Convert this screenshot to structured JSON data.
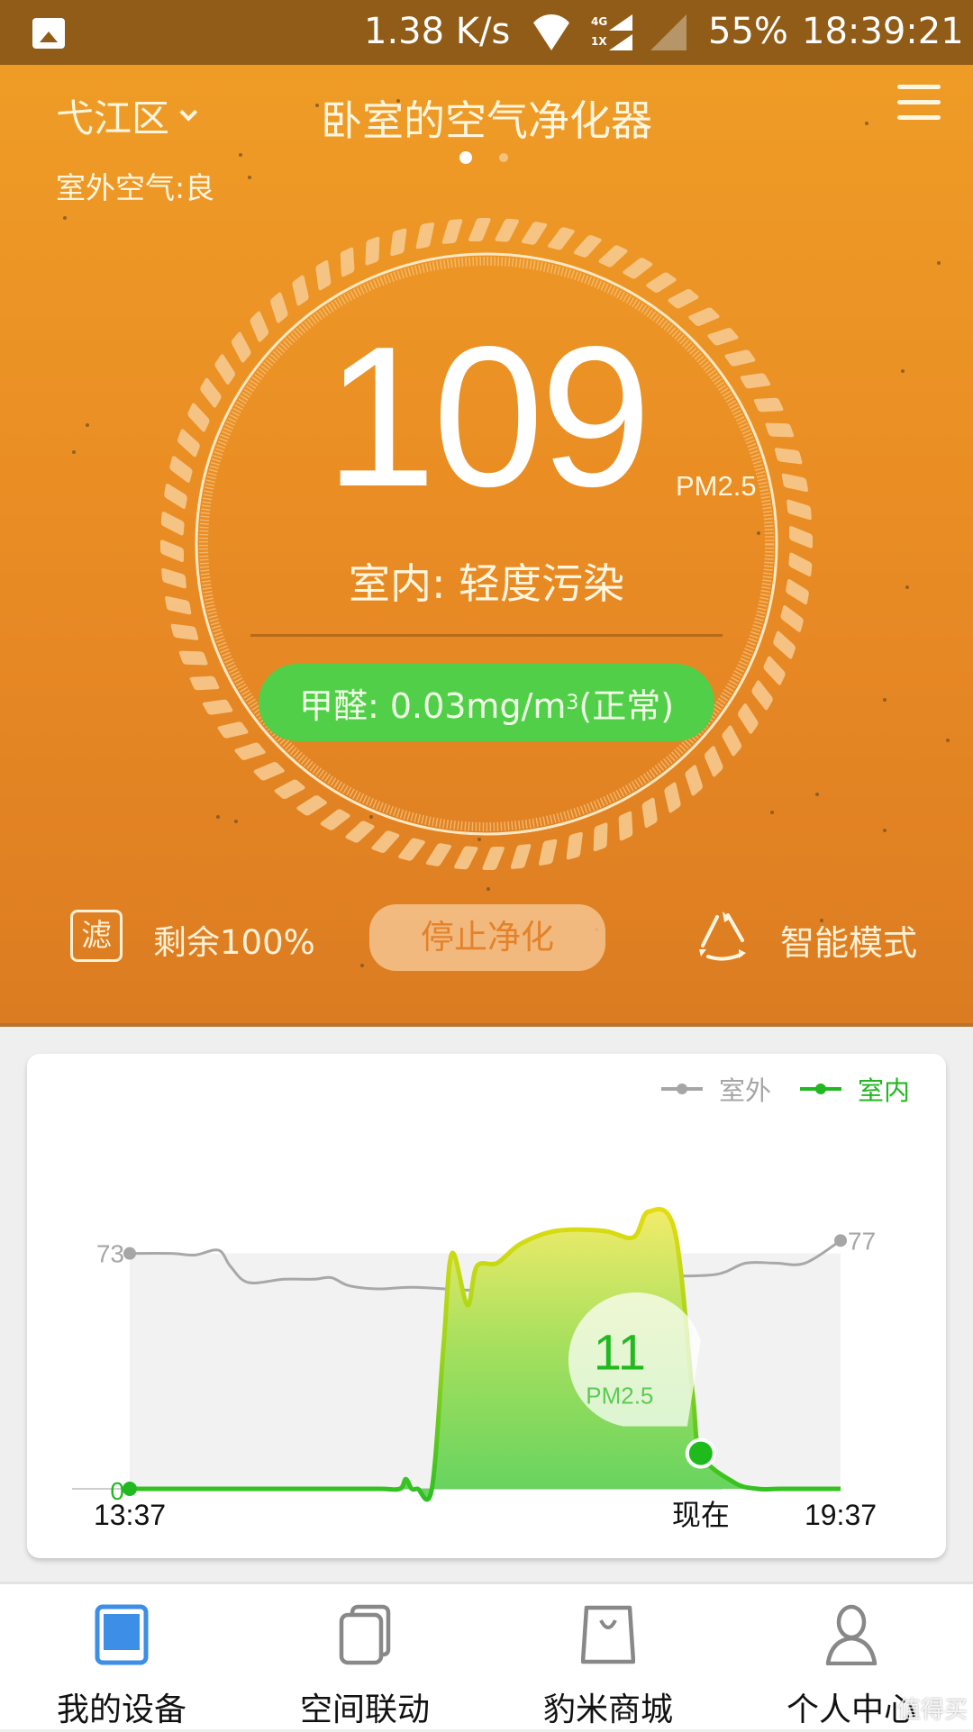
{
  "status_bar": {
    "network_speed": "1.38 K/s",
    "network_type_top": "4G",
    "network_type_bottom": "1X",
    "battery": "55%",
    "time": "18:39:21",
    "icons": [
      "gallery-icon",
      "wifi-icon",
      "signal-icon",
      "signal-empty-icon"
    ]
  },
  "header": {
    "location": "弋江区",
    "title": "卧室的空气净化器",
    "outdoor_air": "室外空气:良",
    "page_count": 2,
    "active_page": 1
  },
  "reading": {
    "pm25_value": "109",
    "pm25_unit": "PM2.5",
    "indoor_status": "室内:  轻度污染",
    "formaldehyde_label": "甲醛:  0.03mg/m",
    "formaldehyde_sup": "3",
    "formaldehyde_status": "(正常)",
    "formaldehyde_color": "#51cf48"
  },
  "controls": {
    "filter_icon_char": "滤",
    "filter_remaining": "剩余100%",
    "stop_label": "停止净化",
    "mode_label": "智能模式"
  },
  "chart_data": {
    "type": "area",
    "title": "",
    "legend": [
      {
        "name": "室外",
        "color": "#a6a6a6"
      },
      {
        "name": "室内",
        "color": "#22b820"
      }
    ],
    "legend_position": "top-right",
    "x_labels": {
      "start": "13:37",
      "now": "现在",
      "end": "19:37"
    },
    "x_range_hours": [
      0,
      6
    ],
    "y_range": [
      0,
      90
    ],
    "start_labels": {
      "outdoor": "73",
      "indoor": "0"
    },
    "end_labels": {
      "outdoor": "77"
    },
    "series": [
      {
        "name": "室外",
        "x": [
          0,
          0.35,
          0.55,
          0.75,
          0.85,
          1.0,
          1.3,
          1.55,
          1.7,
          1.85,
          2.1,
          2.4,
          2.95,
          3.1,
          3.3,
          3.9,
          4.3,
          4.5,
          4.95,
          5.2,
          5.45,
          5.7,
          6.0
        ],
        "values": [
          73,
          73,
          72.5,
          74,
          69,
          64,
          65,
          65,
          65.5,
          63,
          62,
          62.5,
          61.5,
          63,
          66.5,
          66.5,
          66.5,
          66,
          66.5,
          70,
          70,
          70,
          77
        ]
      },
      {
        "name": "室内",
        "x": [
          0,
          1.5,
          2.1,
          2.28,
          2.33,
          2.38,
          2.43,
          2.55,
          2.65,
          2.72,
          2.85,
          2.93,
          3.1,
          3.3,
          3.6,
          4.0,
          4.25,
          4.38,
          4.6,
          4.75,
          4.82,
          5.1,
          5.3,
          5.5,
          6.0
        ],
        "values": [
          0,
          0,
          0,
          0,
          3,
          0,
          0,
          0,
          45,
          73,
          57,
          69,
          70,
          76,
          80,
          80,
          78,
          86,
          80,
          30,
          11,
          2,
          0,
          0,
          0
        ]
      }
    ],
    "tooltip": {
      "value": "11",
      "unit": "PM2.5",
      "x": 4.82
    }
  },
  "tabs": [
    {
      "label": "我的设备",
      "icon": "device-icon",
      "active": true
    },
    {
      "label": "空间联动",
      "icon": "linkage-icon",
      "active": false
    },
    {
      "label": "豹米商城",
      "icon": "shop-bag-icon",
      "active": false
    },
    {
      "label": "个人中心",
      "icon": "person-icon",
      "active": false
    }
  ],
  "watermark": "值得买",
  "colors": {
    "accent_active": "#3d8ee6",
    "tab_inactive": "#888888",
    "hero_orange": "#ee9a26"
  }
}
